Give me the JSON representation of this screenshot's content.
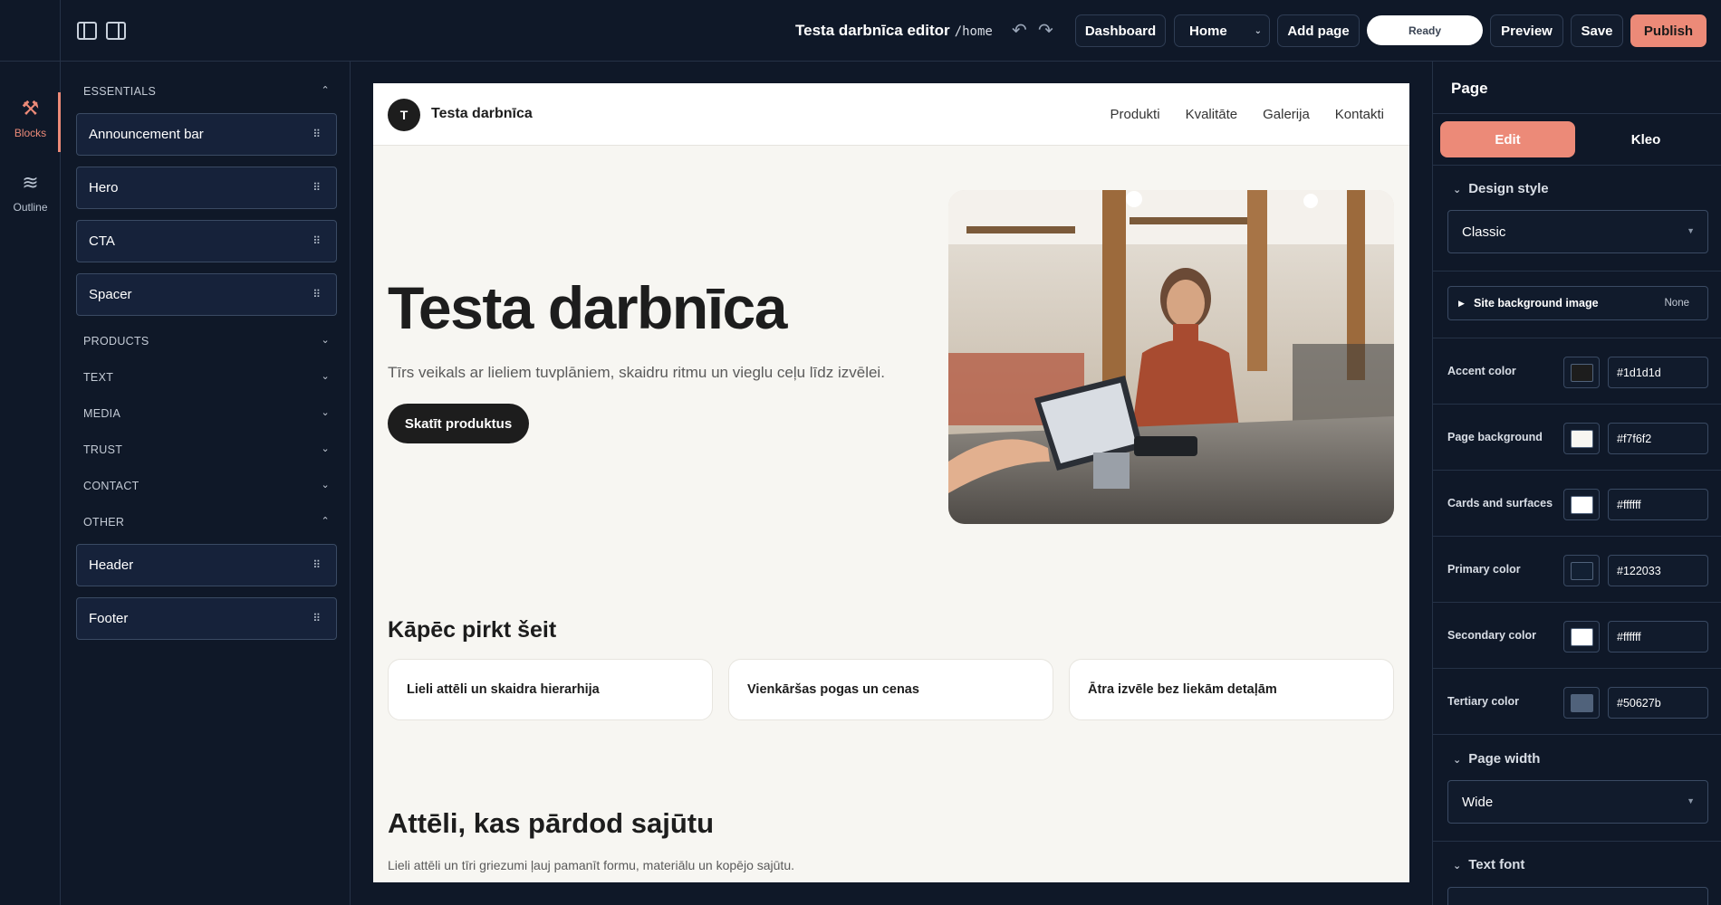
{
  "topbar": {
    "title": "Testa darbnīca editor",
    "path": "/home",
    "dashboard_label": "Dashboard",
    "page_select_value": "Home",
    "add_page_label": "Add page",
    "status_label": "Ready",
    "preview_label": "Preview",
    "save_label": "Save",
    "publish_label": "Publish"
  },
  "rail": {
    "blocks_label": "Blocks",
    "outline_label": "Outline"
  },
  "blocks_panel": {
    "essentials": {
      "label": "ESSENTIALS",
      "items": [
        "Announcement bar",
        "Hero",
        "CTA",
        "Spacer"
      ]
    },
    "collapsed_sections": [
      "PRODUCTS",
      "TEXT",
      "MEDIA",
      "TRUST",
      "CONTACT"
    ],
    "other": {
      "label": "OTHER",
      "items": [
        "Header",
        "Footer"
      ]
    }
  },
  "site": {
    "logo_letter": "T",
    "brand": "Testa darbnīca",
    "nav": [
      "Produkti",
      "Kvalitāte",
      "Galerija",
      "Kontakti"
    ],
    "hero": {
      "title": "Testa darbnīca",
      "subtitle": "Tīrs veikals ar lieliem tuvplāniem, skaidru ritmu un vieglu ceļu līdz izvēlei.",
      "button": "Skatīt produktus"
    },
    "why": {
      "title": "Kāpēc pirkt šeit",
      "cards": [
        "Lieli attēli un skaidra hierarhija",
        "Vienkāršas pogas un cenas",
        "Ātra izvēle bez liekām detaļām"
      ]
    },
    "gallery": {
      "title": "Attēli, kas pārdod sajūtu",
      "subtitle": "Lieli attēli un tīri griezumi ļauj pamanīt formu, materiālu un kopējo sajūtu."
    }
  },
  "right_panel": {
    "title": "Page",
    "tabs": [
      "Edit",
      "Kleo"
    ],
    "design_style": {
      "label": "Design style",
      "value": "Classic"
    },
    "site_background": {
      "label": "Site background image",
      "value": "None"
    },
    "colors": [
      {
        "label": "Accent color",
        "hex": "#1d1d1d"
      },
      {
        "label": "Page background",
        "hex": "#f7f6f2"
      },
      {
        "label": "Cards and surfaces",
        "hex": "#ffffff"
      },
      {
        "label": "Primary color",
        "hex": "#122033"
      },
      {
        "label": "Secondary color",
        "hex": "#ffffff"
      },
      {
        "label": "Tertiary color",
        "hex": "#50627b"
      }
    ],
    "page_width": {
      "label": "Page width",
      "value": "Wide"
    },
    "text_font": {
      "label": "Text font"
    }
  },
  "theme": {
    "accent": "#ec8a78",
    "bg": "#0f1828"
  }
}
